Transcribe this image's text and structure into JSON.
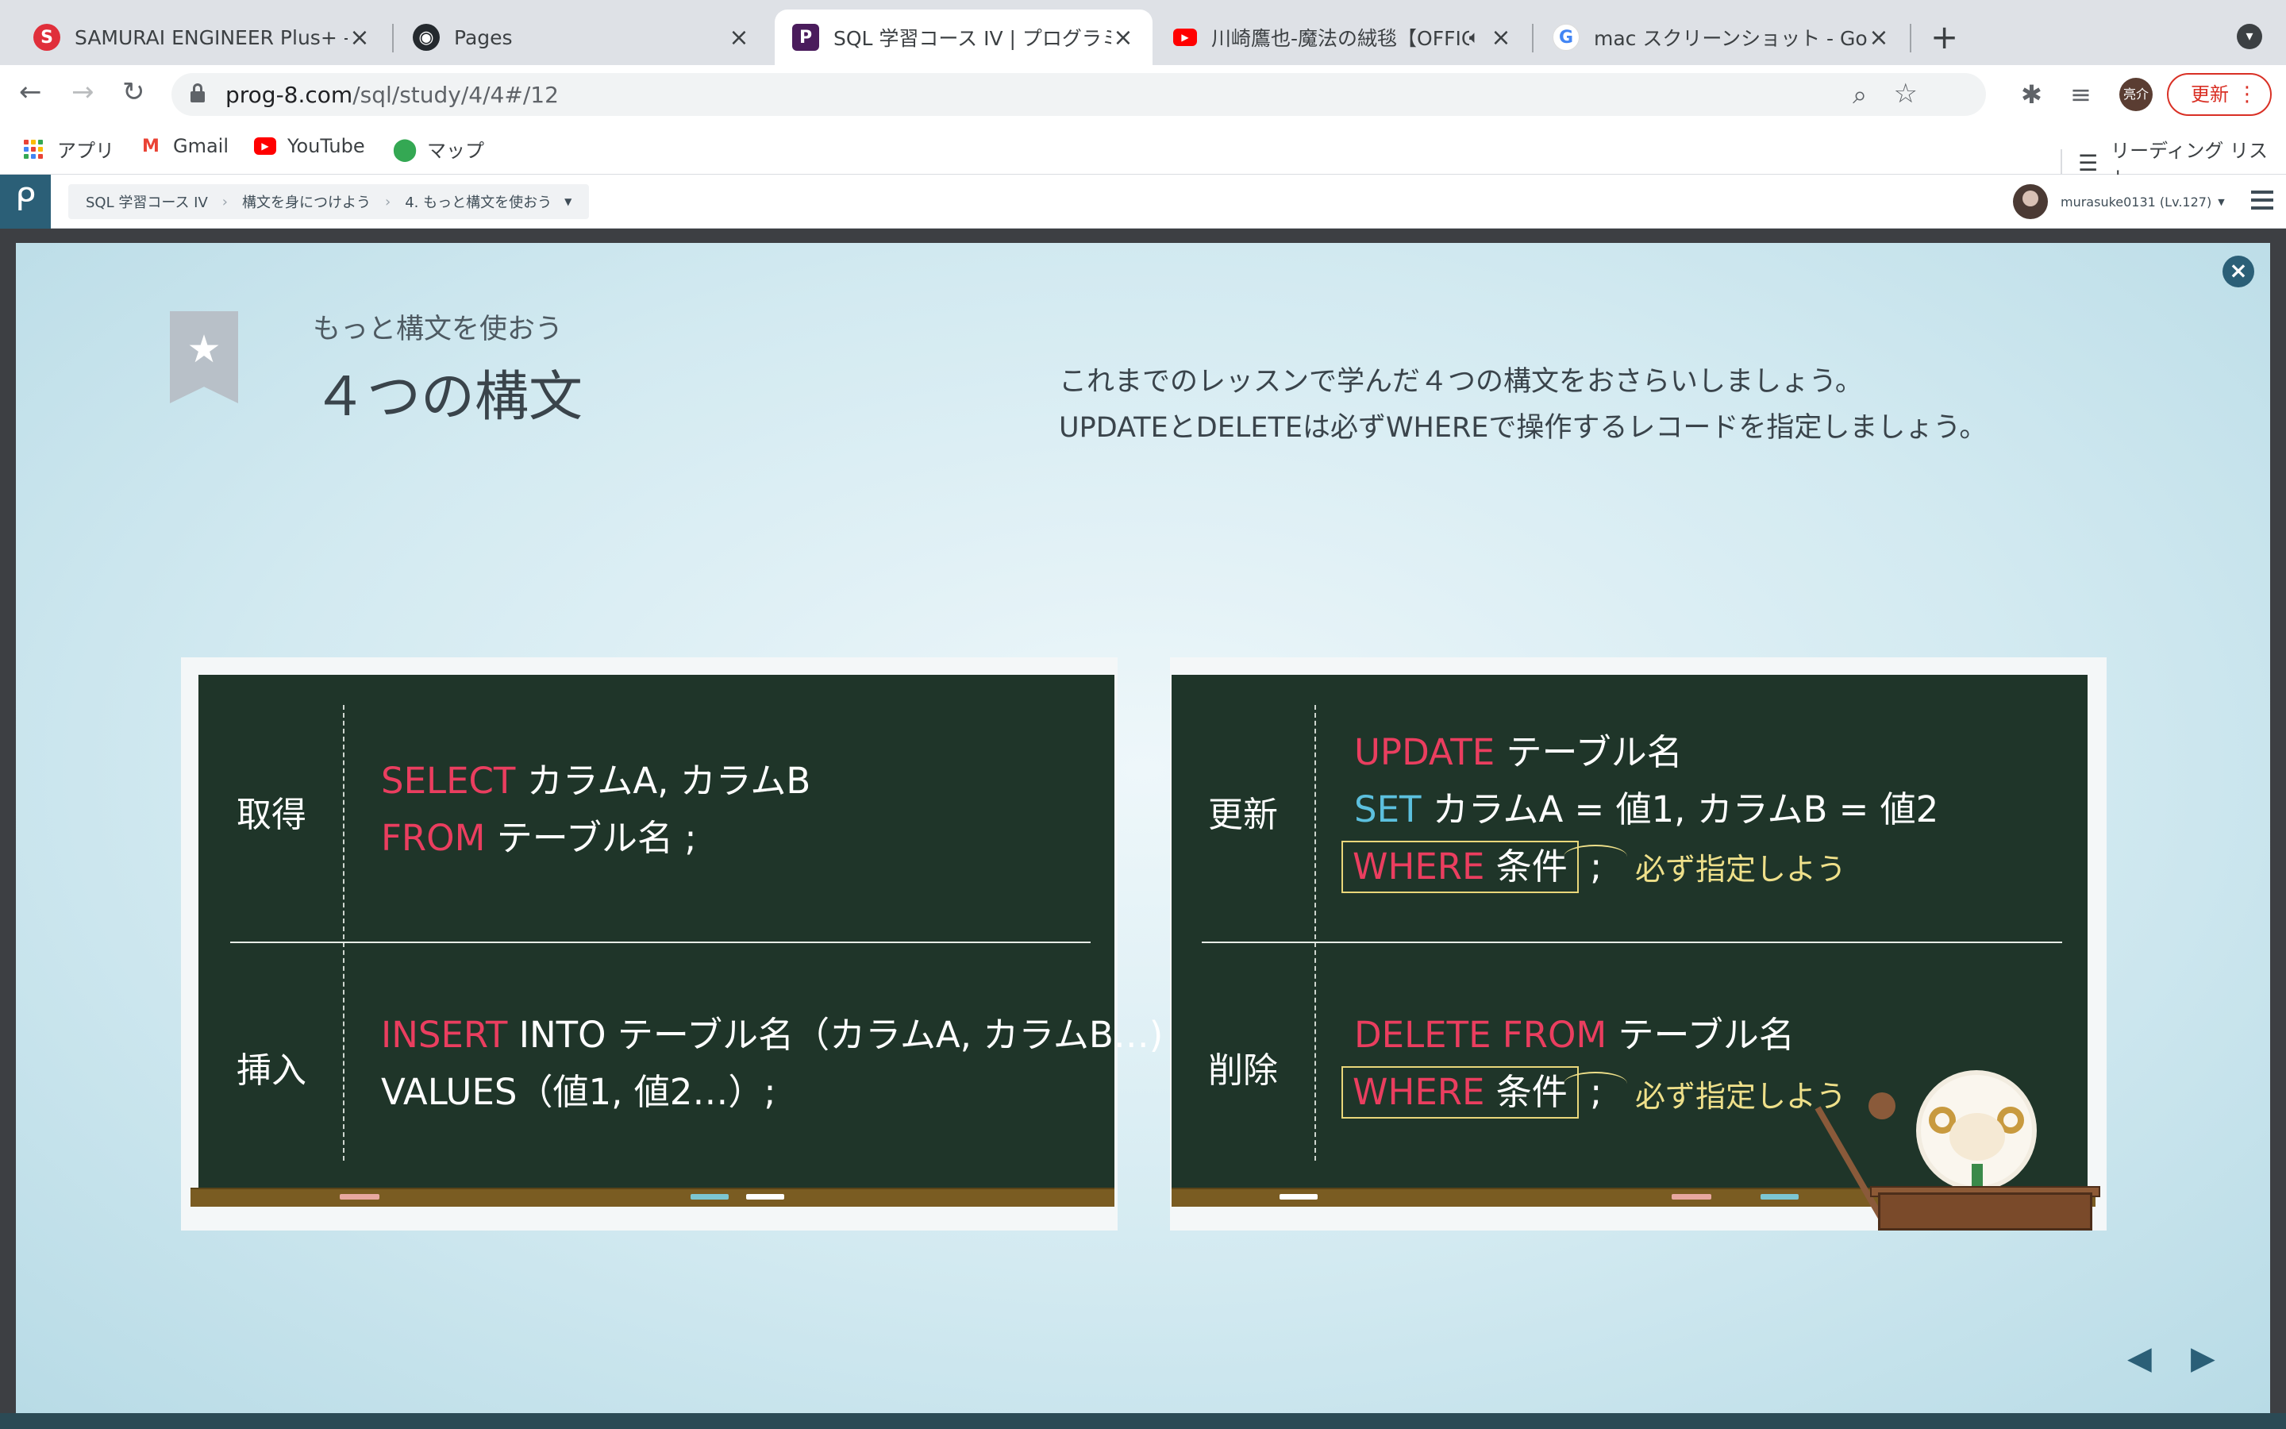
{
  "browser": {
    "tabs": [
      {
        "title": "SAMURAI ENGINEER Plus+ - El",
        "favicon": "samurai-icon"
      },
      {
        "title": "Pages",
        "favicon": "github-icon"
      },
      {
        "title": "SQL 学習コース IV | プログラミン",
        "favicon": "progate-icon",
        "active": true
      },
      {
        "title": "川崎鷹也-魔法の絨毯【OFFIC",
        "favicon": "youtube-icon",
        "audio": true
      },
      {
        "title": "mac スクリーンショット - Google",
        "favicon": "google-icon"
      }
    ],
    "close_glyph": "×",
    "new_tab_glyph": "+",
    "url_host": "prog-8.com",
    "url_path": "/sql/study/4/4#/12",
    "profile_label": "亮介",
    "update_label": "更新",
    "bookmarks": [
      {
        "label": "アプリ",
        "icon": "apps-icon"
      },
      {
        "label": "Gmail",
        "icon": "gmail-icon"
      },
      {
        "label": "YouTube",
        "icon": "youtube-icon"
      },
      {
        "label": "マップ",
        "icon": "maps-icon"
      }
    ],
    "reading_list_label": "リーディング リスト"
  },
  "site": {
    "breadcrumb": [
      "SQL 学習コース IV",
      "構文を身につけよう",
      "4. もっと構文を使おう"
    ],
    "username": "murasuke0131 (Lv.127)"
  },
  "slide": {
    "subtitle": "もっと構文を使おう",
    "title": "４つの構文",
    "description_line1": "これまでのレッスンで学んだ４つの構文をおさらいしましょう。",
    "description_line2": "UPDATEとDELETEは必ずWHEREで操作するレコードを指定しましょう。",
    "left_board": {
      "row1_label": "取得",
      "row1_line1_kw": "SELECT",
      "row1_line1_rest": " カラムA, カラムB",
      "row1_line2_kw": "FROM",
      "row1_line2_rest": " テーブル名 ;",
      "row2_label": "挿入",
      "row2_line1_kw": "INSERT",
      "row2_line1_rest": " INTO テーブル名（カラムA, カラムB…)",
      "row2_line2": "VALUES（値1, 値2…）;"
    },
    "right_board": {
      "row1_label": "更新",
      "row1_line1_kw": "UPDATE",
      "row1_line1_rest": " テーブル名",
      "row1_line2_kw": "SET",
      "row1_line2_rest": " カラムA = 値1, カラムB = 値2",
      "row1_line3_kw": "WHERE",
      "row1_line3_rest": " 条件",
      "row1_line3_end": " ;",
      "row1_note": "必ず指定しよう",
      "row2_label": "削除",
      "row2_line1_kw": "DELETE FROM",
      "row2_line1_rest": " テーブル名",
      "row2_line2_kw": "WHERE",
      "row2_line2_rest": " 条件",
      "row2_line2_end": " ;",
      "row2_note": "必ず指定しよう"
    },
    "prev_glyph": "◀",
    "next_glyph": "▶"
  },
  "colors": {
    "keyword_red": "#ea3e5f",
    "keyword_blue": "#5cc0de",
    "board_green": "#1f3529",
    "note_yellow": "#efe08a",
    "brand": "#2b5f77"
  }
}
